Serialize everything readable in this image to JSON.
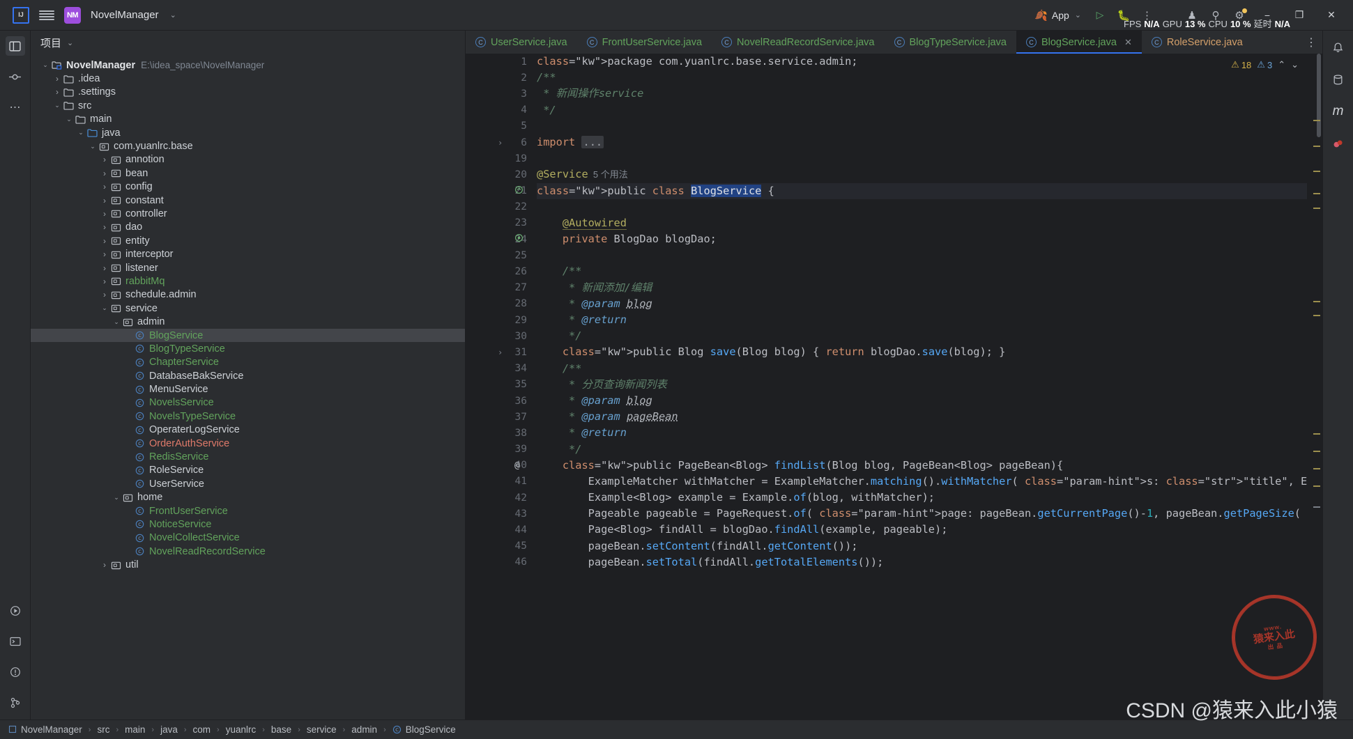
{
  "titlebar": {
    "ide_icon": "intellij-idea-icon",
    "menu_icon": "hamburger-menu-icon",
    "project_badge": "NM",
    "project_name": "NovelManager",
    "chevron": "⌄",
    "run_config": "App",
    "run_icon": "run-icon",
    "debug_icon": "debug-icon",
    "more_icon": "more-actions-icon",
    "account_icon": "account-icon",
    "search_icon": "search-icon",
    "settings_icon": "settings-icon",
    "minimize": "−",
    "maximize": "❐",
    "close": "✕",
    "perf": [
      {
        "key": "FPS",
        "value": "N/A"
      },
      {
        "key": "GPU",
        "value": "13 %"
      },
      {
        "key": "CPU",
        "value": "10 %"
      },
      {
        "key": "延时",
        "value": "N/A"
      }
    ]
  },
  "left_rail": {
    "items": [
      {
        "name": "project-tool-icon",
        "glyph": "▤",
        "active": true
      },
      {
        "name": "commit-tool-icon",
        "glyph": "⌸",
        "active": false
      },
      {
        "name": "more-tool-windows-icon",
        "glyph": "⋯",
        "active": false
      }
    ],
    "bottom_items": [
      {
        "name": "run-tool-icon",
        "glyph": "▷"
      },
      {
        "name": "terminal-tool-icon",
        "glyph": "⬚"
      },
      {
        "name": "problems-tool-icon",
        "glyph": "ⓘ"
      },
      {
        "name": "version-control-icon",
        "glyph": "⎇"
      }
    ]
  },
  "project_panel": {
    "title": "项目",
    "title_chevron": "⌄",
    "tree": [
      {
        "indent": 0,
        "arrow": "down",
        "icon": "module-folder-icon",
        "label": "NovelManager",
        "style": "bold",
        "path": "E:\\idea_space\\NovelManager"
      },
      {
        "indent": 1,
        "arrow": "right",
        "icon": "folder-icon",
        "label": ".idea",
        "style": ""
      },
      {
        "indent": 1,
        "arrow": "right",
        "icon": "folder-icon",
        "label": ".settings",
        "style": ""
      },
      {
        "indent": 1,
        "arrow": "down",
        "icon": "folder-icon",
        "label": "src",
        "style": ""
      },
      {
        "indent": 2,
        "arrow": "down",
        "icon": "folder-icon",
        "label": "main",
        "style": ""
      },
      {
        "indent": 3,
        "arrow": "down",
        "icon": "source-folder-icon",
        "label": "java",
        "style": ""
      },
      {
        "indent": 4,
        "arrow": "down",
        "icon": "package-icon",
        "label": "com.yuanlrc.base",
        "style": ""
      },
      {
        "indent": 5,
        "arrow": "right",
        "icon": "package-icon",
        "label": "annotion",
        "style": ""
      },
      {
        "indent": 5,
        "arrow": "right",
        "icon": "package-icon",
        "label": "bean",
        "style": ""
      },
      {
        "indent": 5,
        "arrow": "right",
        "icon": "package-icon",
        "label": "config",
        "style": ""
      },
      {
        "indent": 5,
        "arrow": "right",
        "icon": "package-icon",
        "label": "constant",
        "style": ""
      },
      {
        "indent": 5,
        "arrow": "right",
        "icon": "package-icon",
        "label": "controller",
        "style": ""
      },
      {
        "indent": 5,
        "arrow": "right",
        "icon": "package-icon",
        "label": "dao",
        "style": ""
      },
      {
        "indent": 5,
        "arrow": "right",
        "icon": "package-icon",
        "label": "entity",
        "style": ""
      },
      {
        "indent": 5,
        "arrow": "right",
        "icon": "package-icon",
        "label": "interceptor",
        "style": ""
      },
      {
        "indent": 5,
        "arrow": "right",
        "icon": "package-icon",
        "label": "listener",
        "style": ""
      },
      {
        "indent": 5,
        "arrow": "right",
        "icon": "package-icon",
        "label": "rabbitMq",
        "style": "green"
      },
      {
        "indent": 5,
        "arrow": "right",
        "icon": "package-icon",
        "label": "schedule.admin",
        "style": ""
      },
      {
        "indent": 5,
        "arrow": "down",
        "icon": "package-icon",
        "label": "service",
        "style": ""
      },
      {
        "indent": 6,
        "arrow": "down",
        "icon": "package-icon",
        "label": "admin",
        "style": ""
      },
      {
        "indent": 7,
        "arrow": "none",
        "icon": "class-icon",
        "label": "BlogService",
        "style": "green",
        "selected": true
      },
      {
        "indent": 7,
        "arrow": "none",
        "icon": "class-icon",
        "label": "BlogTypeService",
        "style": "green"
      },
      {
        "indent": 7,
        "arrow": "none",
        "icon": "class-icon",
        "label": "ChapterService",
        "style": "green"
      },
      {
        "indent": 7,
        "arrow": "none",
        "icon": "class-icon",
        "label": "DatabaseBakService",
        "style": ""
      },
      {
        "indent": 7,
        "arrow": "none",
        "icon": "class-icon",
        "label": "MenuService",
        "style": ""
      },
      {
        "indent": 7,
        "arrow": "none",
        "icon": "class-icon",
        "label": "NovelsService",
        "style": "green"
      },
      {
        "indent": 7,
        "arrow": "none",
        "icon": "class-icon",
        "label": "NovelsTypeService",
        "style": "green"
      },
      {
        "indent": 7,
        "arrow": "none",
        "icon": "class-icon",
        "label": "OperaterLogService",
        "style": ""
      },
      {
        "indent": 7,
        "arrow": "none",
        "icon": "class-icon",
        "label": "OrderAuthService",
        "style": "red"
      },
      {
        "indent": 7,
        "arrow": "none",
        "icon": "class-icon",
        "label": "RedisService",
        "style": "green"
      },
      {
        "indent": 7,
        "arrow": "none",
        "icon": "class-icon",
        "label": "RoleService",
        "style": ""
      },
      {
        "indent": 7,
        "arrow": "none",
        "icon": "class-icon",
        "label": "UserService",
        "style": ""
      },
      {
        "indent": 6,
        "arrow": "down",
        "icon": "package-icon",
        "label": "home",
        "style": ""
      },
      {
        "indent": 7,
        "arrow": "none",
        "icon": "class-icon",
        "label": "FrontUserService",
        "style": "green"
      },
      {
        "indent": 7,
        "arrow": "none",
        "icon": "class-icon",
        "label": "NoticeService",
        "style": "green"
      },
      {
        "indent": 7,
        "arrow": "none",
        "icon": "class-icon",
        "label": "NovelCollectService",
        "style": "green"
      },
      {
        "indent": 7,
        "arrow": "none",
        "icon": "class-icon",
        "label": "NovelReadRecordService",
        "style": "green"
      },
      {
        "indent": 5,
        "arrow": "right",
        "icon": "package-icon",
        "label": "util",
        "style": ""
      }
    ]
  },
  "editor": {
    "tabs": [
      {
        "label": "UserService.java",
        "active": false,
        "color": "green"
      },
      {
        "label": "FrontUserService.java",
        "active": false,
        "color": "green"
      },
      {
        "label": "NovelReadRecordService.java",
        "active": false,
        "color": "green"
      },
      {
        "label": "BlogTypeService.java",
        "active": false,
        "color": "green"
      },
      {
        "label": "BlogService.java",
        "active": true,
        "color": "green",
        "close": "✕"
      },
      {
        "label": "RoleService.java",
        "active": false,
        "color": "orange"
      }
    ],
    "tabs_overflow_icon": "more-tabs-icon",
    "inspection": {
      "warnings": "18",
      "weak": "3",
      "warn_icon": "warning-triangle-icon",
      "info_icon": "info-icon",
      "up": "⌃",
      "down": "⌄"
    },
    "line_numbers": [
      "1",
      "2",
      "3",
      "4",
      "5",
      "6",
      "19",
      "20",
      "21",
      "22",
      "23",
      "24",
      "25",
      "26",
      "27",
      "28",
      "29",
      "30",
      "31",
      "34",
      "35",
      "36",
      "37",
      "38",
      "39",
      "40",
      "41",
      "42",
      "43",
      "44",
      "45",
      "46"
    ],
    "code_lines": [
      "package com.yuanlrc.base.service.admin;",
      "/**",
      " * 新闻操作service",
      " */",
      "",
      "import ...",
      "",
      "@Service  5 个用法",
      "public class BlogService {",
      "",
      "    @Autowired",
      "    private BlogDao blogDao;",
      "",
      "    /**",
      "     * 新闻添加/编辑",
      "     * @param blog",
      "     * @return",
      "     */",
      "    public Blog save(Blog blog) { return blogDao.save(blog); }",
      "    /**",
      "     * 分页查询新闻列表",
      "     * @param blog",
      "     * @param pageBean",
      "     * @return",
      "     */",
      "    public PageBean<Blog> findList(Blog blog, PageBean<Blog> pageBean){",
      "        ExampleMatcher withMatcher = ExampleMatcher.matching().withMatcher( s: \"title\", ExampleMatch",
      "        Example<Blog> example = Example.of(blog, withMatcher);",
      "        Pageable pageable = PageRequest.of( page: pageBean.getCurrentPage()-1, pageBean.getPageSize(",
      "        Page<Blog> findAll = blogDao.findAll(example, pageable);",
      "        pageBean.setContent(findAll.getContent());",
      "        pageBean.setTotal(findAll.getTotalElements());"
    ],
    "usage_hint": "5 个用法",
    "gutter_marks": [
      {
        "line_index": 8,
        "icon": "class-bean-icon"
      },
      {
        "line_index": 11,
        "icon": "autowired-bean-icon"
      },
      {
        "line_index": 25,
        "icon": "override-annotation-icon"
      }
    ]
  },
  "right_rail": {
    "items": [
      {
        "name": "notifications-icon",
        "glyph": "ὑ4"
      },
      {
        "name": "maven-icon",
        "glyph": "m"
      },
      {
        "name": "database-icon",
        "glyph": "⛃"
      },
      {
        "name": "bookmarks-icon",
        "glyph": "⚑"
      }
    ]
  },
  "statusbar": {
    "breadcrumbs": [
      {
        "icon": "module-icon",
        "label": "NovelManager"
      },
      {
        "icon": "",
        "label": "src"
      },
      {
        "icon": "",
        "label": "main"
      },
      {
        "icon": "",
        "label": "java"
      },
      {
        "icon": "",
        "label": "com"
      },
      {
        "icon": "",
        "label": "yuanlrc"
      },
      {
        "icon": "",
        "label": "base"
      },
      {
        "icon": "",
        "label": "service"
      },
      {
        "icon": "",
        "label": "admin"
      },
      {
        "icon": "class-icon",
        "label": "BlogService"
      }
    ],
    "separator": "›"
  },
  "watermark": {
    "stamp_line1": "猿来入此",
    "stamp_top": "www.",
    "stamp_bottom": "出 品",
    "text": "CSDN @猿来入此小猿"
  },
  "colors": {
    "accent": "#3573f0",
    "green": "#62a35c",
    "red": "#e07a6a",
    "orange": "#d4a06a",
    "bg": "#2b2d30",
    "editor_bg": "#1e1f22"
  }
}
